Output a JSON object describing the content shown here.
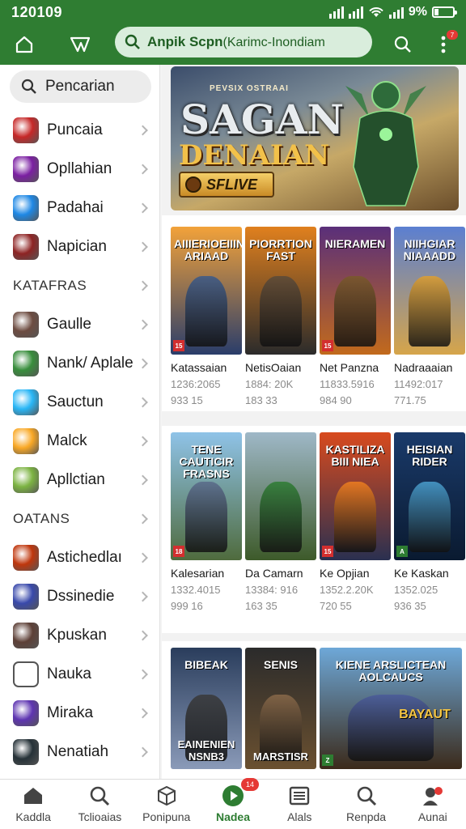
{
  "status_bar": {
    "time": "120109",
    "battery": "9%",
    "battery_level": 0.2
  },
  "toolbar": {
    "search_bold": "Anpik Scpn",
    "search_rest": "(Karimc-Inondiam",
    "notification_count": "7"
  },
  "sidebar": {
    "search_label": "Pencarian",
    "items_top": [
      {
        "label": "Puncaia",
        "icon": "anatomy-heart-app-icon",
        "color": "#c62828"
      },
      {
        "label": "Opllahian",
        "icon": "colorful-swirl-app-icon",
        "color": "#7b1fa2"
      },
      {
        "label": "Padahai",
        "icon": "character-app-icon",
        "color": "#1e88e5"
      },
      {
        "label": "Napician",
        "icon": "hero-app-icon",
        "color": "#8e2424"
      }
    ],
    "section1": "KATAFRAS",
    "items_mid": [
      {
        "label": "Gaulle",
        "icon": "soldier-app-icon",
        "color": "#6d4c41"
      },
      {
        "label": "Nank/ Aplale",
        "icon": "green-block-app-icon",
        "color": "#388e3c"
      },
      {
        "label": "Sauctun",
        "icon": "blue-figure-app-icon",
        "color": "#29b6f6"
      },
      {
        "label": "Malck",
        "icon": "wizard-app-icon",
        "color": "#f9a825"
      },
      {
        "label": "Apllctian",
        "icon": "pixel-app-icon",
        "color": "#7cb342"
      }
    ],
    "section2": "OATANS",
    "items_bottom": [
      {
        "label": "Astichedlaı",
        "icon": "fire-app-icon",
        "color": "#bf360c"
      },
      {
        "label": "Dssinedie",
        "icon": "blue-warrior-app-icon",
        "color": "#3949ab"
      },
      {
        "label": "Kpuskan",
        "icon": "brown-knight-app-icon",
        "color": "#5d4037"
      },
      {
        "label": "Nauka",
        "icon": "clipboard-app-icon",
        "color": "#ffffff"
      },
      {
        "label": "Miraka",
        "icon": "crossed-swords-app-icon",
        "color": "#5e35b1"
      },
      {
        "label": "Nenatiah",
        "icon": "dark-soldier-app-icon",
        "color": "#263238"
      }
    ]
  },
  "banner": {
    "small_text": "PEVSIX OSTRAAI",
    "title1": "SAGAN",
    "title2": "DENAIAN",
    "cta": "SFLIVE"
  },
  "row1": [
    {
      "title": "AIIIERIOEIIIN ARIAAD",
      "name": "Katassaian",
      "n1": "1236:2065",
      "n2": "933 15",
      "badge": "15",
      "c1": "#f2a23a",
      "c2": "#2a3d6a",
      "fig": "#3a5a8c"
    },
    {
      "title": "PIORRTION FAST",
      "name": "NetisOaian",
      "n1": "1884: 20K",
      "n2": "183 33",
      "badge": "",
      "c1": "#e0801e",
      "c2": "#2b2b2b",
      "fig": "#5a4a3a"
    },
    {
      "title": "NIERAMEN",
      "name": "Net Panzna",
      "n1": "11833.5916",
      "n2": "984 90",
      "badge": "15",
      "c1": "#5a2f7a",
      "c2": "#c26a1c",
      "fig": "#7a5a2a"
    },
    {
      "title": "NIIHGIAR NIAAADD",
      "name": "Nadraaaian",
      "n1": "11492:017",
      "n2": "771.75",
      "badge": "",
      "c1": "#5b7fd1",
      "c2": "#d6a54a",
      "fig": "#e0a030"
    }
  ],
  "row2": [
    {
      "title": "TENE CAUTICIR FRASNS",
      "name": "Kalesarian",
      "n1": "1332.4015",
      "n2": "999 16",
      "badge": "18",
      "c1": "#8fc3e8",
      "c2": "#4f6b3d",
      "fig": "#5a6a8a"
    },
    {
      "title": "",
      "name": "Da Camarn",
      "n1": "13384: 916",
      "n2": "163 35",
      "badge": "",
      "c1": "#9fb8c8",
      "c2": "#3d5a2a",
      "fig": "#2e7d32"
    },
    {
      "title": "KASTILIZA BIII NIEA",
      "name": "Ke Opjian",
      "n1": "1352.2.20K",
      "n2": "720 55",
      "badge": "15",
      "c1": "#d84a1e",
      "c2": "#2a3050",
      "fig": "#f08020"
    },
    {
      "title": "HEISIAN RIDER",
      "name": "Ke Kaskan",
      "n1": "1352.025",
      "n2": "936 35",
      "badge": "A",
      "c1": "#1a3a6a",
      "c2": "#0a1a30",
      "fig": "#4aa0d0"
    }
  ],
  "row3": [
    {
      "title": "BIBEAK",
      "bottom": "EAINENIEN NSNB3",
      "badge": "",
      "c1": "#2a3d5c",
      "c2": "#8a9ab8",
      "fig": "#3a3a3a"
    },
    {
      "title": "SENIS",
      "bottom": "MARSTISR",
      "badge": "",
      "c1": "#2b2b2b",
      "c2": "#6a5030",
      "fig": "#8a6a4a"
    },
    {
      "title": "KIENE ARSLICTEAN AOLCAUCS",
      "title2": "BAYAUT",
      "badge": "Z",
      "c1": "#6ea8d8",
      "c2": "#3b2a1a",
      "fig": "#4a5a9a"
    }
  ],
  "bottom_nav": [
    {
      "label": "Kaddla",
      "icon": "home-icon"
    },
    {
      "label": "Tclioaias",
      "icon": "search-icon"
    },
    {
      "label": "Ponipuna",
      "icon": "box-icon"
    },
    {
      "label": "Nadea",
      "icon": "play-icon",
      "badge": "14"
    },
    {
      "label": "Alals",
      "icon": "list-icon"
    },
    {
      "label": "Renpda",
      "icon": "search-icon"
    },
    {
      "label": "Aunai",
      "icon": "account-icon"
    }
  ]
}
